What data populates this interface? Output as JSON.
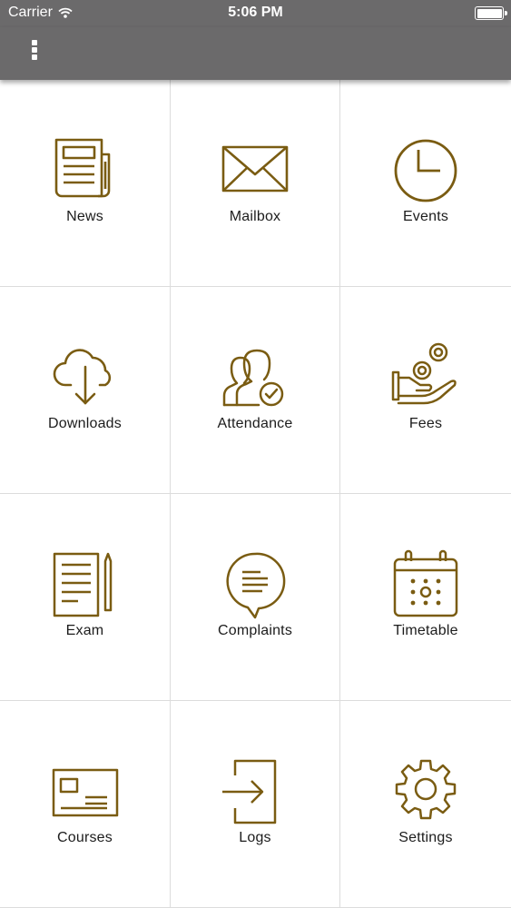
{
  "status_bar": {
    "carrier": "Carrier",
    "time": "5:06 PM"
  },
  "nav": {
    "menu_icon": "more-vertical-icon"
  },
  "accent_color": "#7a5c12",
  "tiles": [
    {
      "label": "News",
      "icon": "newspaper-icon"
    },
    {
      "label": "Mailbox",
      "icon": "envelope-icon"
    },
    {
      "label": "Events",
      "icon": "clock-icon"
    },
    {
      "label": "Downloads",
      "icon": "cloud-download-icon"
    },
    {
      "label": "Attendance",
      "icon": "users-check-icon"
    },
    {
      "label": "Fees",
      "icon": "hand-coins-icon"
    },
    {
      "label": "Exam",
      "icon": "exam-paper-icon"
    },
    {
      "label": "Complaints",
      "icon": "chat-bubble-icon"
    },
    {
      "label": "Timetable",
      "icon": "calendar-icon"
    },
    {
      "label": "Courses",
      "icon": "id-card-icon"
    },
    {
      "label": "Logs",
      "icon": "login-icon"
    },
    {
      "label": "Settings",
      "icon": "gear-icon"
    }
  ]
}
